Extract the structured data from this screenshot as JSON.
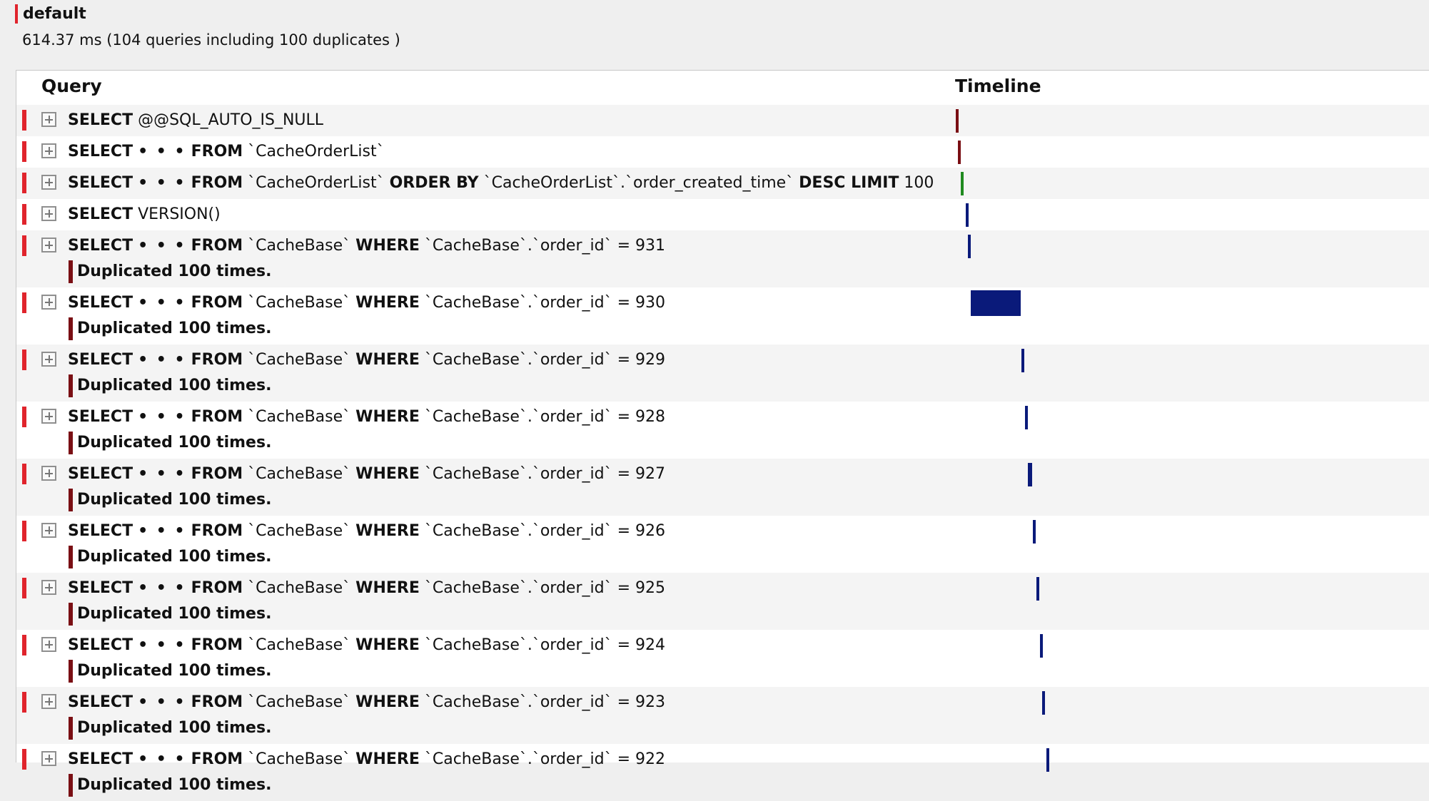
{
  "header": {
    "title": "default",
    "summary": "614.37 ms (104 queries including 100 duplicates )"
  },
  "columns": {
    "query": "Query",
    "timeline": "Timeline"
  },
  "keywords": {
    "select": "SELECT",
    "from": "FROM",
    "where": "WHERE",
    "order_by": "ORDER BY",
    "desc_limit": "DESC LIMIT",
    "ellipsis": "• • •"
  },
  "colors": {
    "marker": "#e0242c",
    "duplicate_marker": "#7a0f14",
    "bar_default": "#7a0f14",
    "bar_green": "#1f8a1f",
    "bar_navy": "#0a1a7a"
  },
  "queries": [
    {
      "kind": "plain",
      "body": "@@SQL_AUTO_IS_NULL",
      "duplicate": null,
      "timeline": {
        "start_pct": 0.0,
        "width_pct": 0.2,
        "color": "#7a0f14"
      }
    },
    {
      "kind": "from",
      "table": "`CacheOrderList`",
      "duplicate": null,
      "timeline": {
        "start_pct": 0.5,
        "width_pct": 0.4,
        "color": "#7a0f14"
      }
    },
    {
      "kind": "order",
      "table": "`CacheOrderList`",
      "order_col": "`CacheOrderList`.`order_created_time`",
      "limit": "100",
      "duplicate": null,
      "timeline": {
        "start_pct": 1.1,
        "width_pct": 0.4,
        "color": "#1f8a1f"
      }
    },
    {
      "kind": "plain",
      "body": "VERSION()",
      "duplicate": null,
      "timeline": {
        "start_pct": 2.1,
        "width_pct": 0.2,
        "color": "#0a1a7a"
      }
    },
    {
      "kind": "where",
      "table": "`CacheBase`",
      "column": "`CacheBase`.`order_id`",
      "op": " = ",
      "value": "931",
      "duplicate": "Duplicated 100 times.",
      "timeline": {
        "start_pct": 2.6,
        "width_pct": 0.5,
        "color": "#0a1a7a"
      }
    },
    {
      "kind": "where",
      "table": "`CacheBase`",
      "column": "`CacheBase`.`order_id`",
      "op": " = ",
      "value": "930",
      "duplicate": "Duplicated 100 times.",
      "timeline": {
        "start_pct": 3.3,
        "width_pct": 10.9,
        "color": "#0a1a7a"
      }
    },
    {
      "kind": "where",
      "table": "`CacheBase`",
      "column": "`CacheBase`.`order_id`",
      "op": " = ",
      "value": "929",
      "duplicate": "Duplicated 100 times.",
      "timeline": {
        "start_pct": 14.2,
        "width_pct": 0.5,
        "color": "#0a1a7a"
      }
    },
    {
      "kind": "where",
      "table": "`CacheBase`",
      "column": "`CacheBase`.`order_id`",
      "op": " = ",
      "value": "928",
      "duplicate": "Duplicated 100 times.",
      "timeline": {
        "start_pct": 15.0,
        "width_pct": 0.5,
        "color": "#0a1a7a"
      }
    },
    {
      "kind": "where",
      "table": "`CacheBase`",
      "column": "`CacheBase`.`order_id`",
      "op": " = ",
      "value": "927",
      "duplicate": "Duplicated 100 times.",
      "timeline": {
        "start_pct": 15.6,
        "width_pct": 0.9,
        "color": "#0a1a7a"
      }
    },
    {
      "kind": "where",
      "table": "`CacheBase`",
      "column": "`CacheBase`.`order_id`",
      "op": " = ",
      "value": "926",
      "duplicate": "Duplicated 100 times.",
      "timeline": {
        "start_pct": 16.7,
        "width_pct": 0.6,
        "color": "#0a1a7a"
      }
    },
    {
      "kind": "where",
      "table": "`CacheBase`",
      "column": "`CacheBase`.`order_id`",
      "op": " = ",
      "value": "925",
      "duplicate": "Duplicated 100 times.",
      "timeline": {
        "start_pct": 17.5,
        "width_pct": 0.6,
        "color": "#0a1a7a"
      }
    },
    {
      "kind": "where",
      "table": "`CacheBase`",
      "column": "`CacheBase`.`order_id`",
      "op": " = ",
      "value": "924",
      "duplicate": "Duplicated 100 times.",
      "timeline": {
        "start_pct": 18.2,
        "width_pct": 0.5,
        "color": "#0a1a7a"
      }
    },
    {
      "kind": "where",
      "table": "`CacheBase`",
      "column": "`CacheBase`.`order_id`",
      "op": " = ",
      "value": "923",
      "duplicate": "Duplicated 100 times.",
      "timeline": {
        "start_pct": 18.8,
        "width_pct": 0.6,
        "color": "#0a1a7a"
      }
    },
    {
      "kind": "where",
      "table": "`CacheBase`",
      "column": "`CacheBase`.`order_id`",
      "op": " = ",
      "value": "922",
      "duplicate": "Duplicated 100 times.",
      "timeline": {
        "start_pct": 19.7,
        "width_pct": 0.6,
        "color": "#0a1a7a"
      }
    }
  ]
}
